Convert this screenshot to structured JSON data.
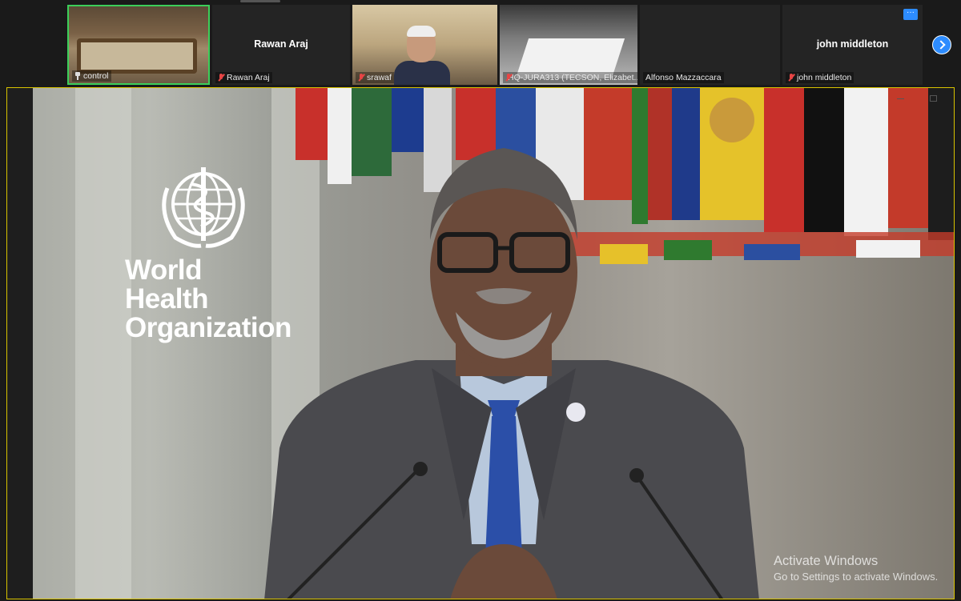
{
  "participants": [
    {
      "id": "control",
      "label": "control",
      "icon": "pin-icon",
      "has_video": true
    },
    {
      "id": "rawan",
      "label": "Rawan Araj",
      "display_name": "Rawan Araj",
      "icon": "mic-off-icon",
      "has_video": false
    },
    {
      "id": "srawaf",
      "label": "srawaf",
      "icon": "mic-off-icon",
      "has_video": true
    },
    {
      "id": "hq",
      "label": "HQ-JURA313 (TECSON, Elizabet...",
      "icon": "mic-off-icon",
      "has_video": true
    },
    {
      "id": "alfonso",
      "label": "Alfonso Mazzaccara",
      "has_video": false
    },
    {
      "id": "john",
      "label": "john middleton",
      "display_name": "john middleton",
      "icon": "mic-off-icon",
      "has_video": false,
      "menu_label": "···"
    }
  ],
  "main_video": {
    "logo_line1": "World Health",
    "logo_line2": "Organization"
  },
  "watermark": {
    "title": "Activate Windows",
    "subtitle": "Go to Settings to activate Windows."
  },
  "colors": {
    "active_speaker_border": "#3ccf5a",
    "accent": "#2d8cff",
    "main_border": "#d9c400",
    "muted": "#e84545"
  }
}
